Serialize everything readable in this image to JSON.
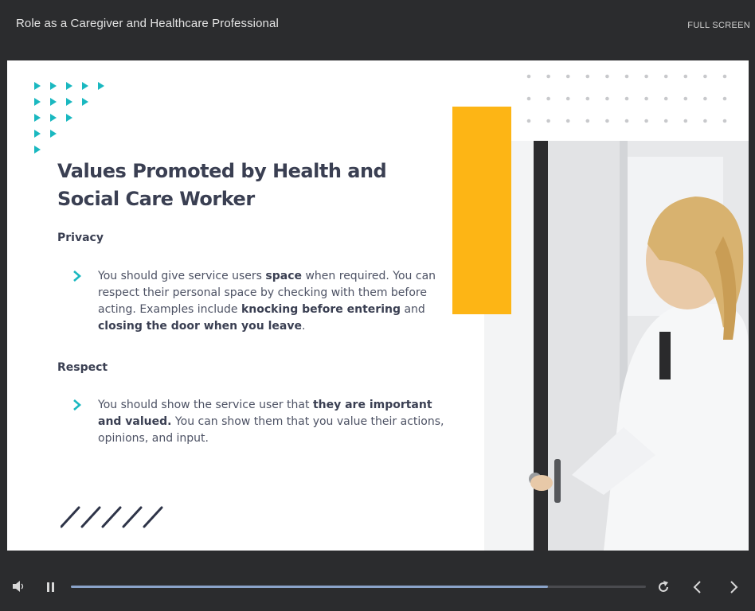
{
  "header": {
    "course_title": "Role as a Caregiver and Healthcare Professional",
    "fullscreen_label": "FULL SCREEN"
  },
  "slide": {
    "heading": "Values Promoted by Health and Social Care Worker",
    "sections": [
      {
        "title": "Privacy",
        "bullet_runs": [
          {
            "text": "You should give service users ",
            "bold": false
          },
          {
            "text": "space",
            "bold": true
          },
          {
            "text": " when required. You can respect their personal space by checking with them before acting. Examples include ",
            "bold": false
          },
          {
            "text": "knocking before entering",
            "bold": true
          },
          {
            "text": " and ",
            "bold": false
          },
          {
            "text": "closing the door when you leave",
            "bold": true
          },
          {
            "text": ".",
            "bold": false
          }
        ]
      },
      {
        "title": "Respect",
        "bullet_runs": [
          {
            "text": "You should show the service user that ",
            "bold": false
          },
          {
            "text": "they are important and valued.",
            "bold": true
          },
          {
            "text": " You can show them that you value their actions, opinions, and input.",
            "bold": false
          }
        ]
      }
    ],
    "colors": {
      "accent_teal": "#1ab8c0",
      "accent_yellow": "#fdb515",
      "heading_navy": "#3a3f52"
    }
  },
  "player": {
    "progress": 0.83,
    "icons": [
      "volume-icon",
      "pause-icon",
      "replay-icon",
      "previous-icon",
      "next-icon"
    ],
    "progress_color": "#8aa3c9"
  }
}
